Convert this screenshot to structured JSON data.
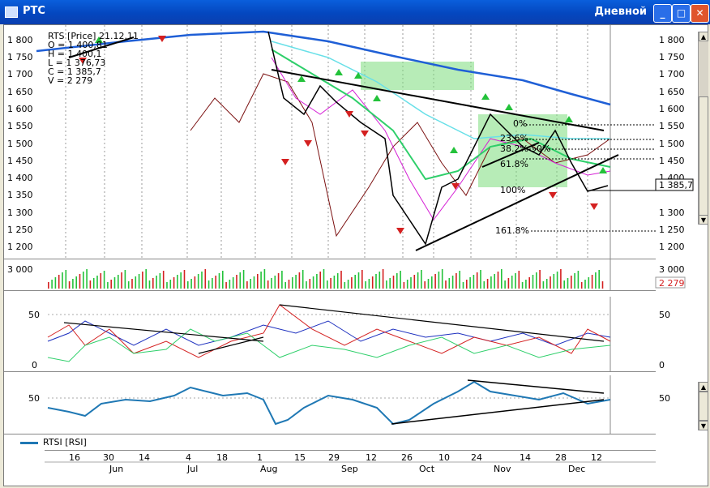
{
  "window": {
    "title": "РТС",
    "right_title": "Дневной",
    "min": "_",
    "max": "□",
    "close": "✕"
  },
  "info": {
    "line1": "RTS [Price] 21.12.11",
    "open": "O = 1 400,81",
    "high": "H = 1 400,1",
    "low": "L = 1 376,73",
    "close": "C = 1 385,7",
    "volume": "V = 2 279"
  },
  "price_axis": [
    "1 800",
    "1 750",
    "1 700",
    "1 650",
    "1 600",
    "1 550",
    "1 500",
    "1 450",
    "1 400",
    "1 350",
    "1 300",
    "1 250",
    "1 200"
  ],
  "price_marker": "1 385,7",
  "fib": [
    "0%",
    "23.6%",
    "38.2%",
    "50%",
    "61.8%",
    "100%",
    "161.8%"
  ],
  "volume_axis": "3 000",
  "volume_marker": "2 279",
  "adx_axis": [
    "50",
    "0"
  ],
  "rsi_axis": "50",
  "legend": "RTSI [RSI]",
  "dates": [
    "16",
    "30",
    "14",
    "4",
    "18",
    "1",
    "15",
    "29",
    "12",
    "26",
    "10",
    "24",
    "14",
    "28",
    "12"
  ],
  "months": [
    "Jun",
    "Jul",
    "Aug",
    "Sep",
    "Oct",
    "Nov",
    "Dec"
  ],
  "colors": {
    "accent": "#0054e3",
    "price": "#000000",
    "ma_blue": "#1f5fd6",
    "ma_green": "#2ecf6a",
    "up": "#23c23a",
    "down": "#d42020",
    "rsi": "#1f78b4"
  },
  "chart_data": [
    {
      "type": "line",
      "title": "RTS [Price]",
      "ylim": [
        1200,
        1800
      ],
      "x": [
        "Jun",
        "Jul",
        "Aug",
        "Sep",
        "Oct",
        "Nov",
        "Dec"
      ],
      "series": [
        {
          "name": "RTS",
          "values": [
            1760,
            1790,
            1810,
            1620,
            1320,
            1580,
            1386
          ]
        }
      ]
    },
    {
      "type": "bar",
      "ylim": [
        0,
        3000
      ],
      "series": [
        {
          "name": "Volume",
          "values": [
            2279
          ]
        }
      ]
    },
    {
      "type": "line",
      "ylim": [
        0,
        60
      ]
    },
    {
      "type": "line",
      "ylim": [
        0,
        100
      ],
      "series": [
        {
          "name": "RTSI [RSI]",
          "values": [
            42,
            38,
            55,
            60,
            30,
            45,
            68,
            50,
            44
          ]
        }
      ]
    }
  ]
}
